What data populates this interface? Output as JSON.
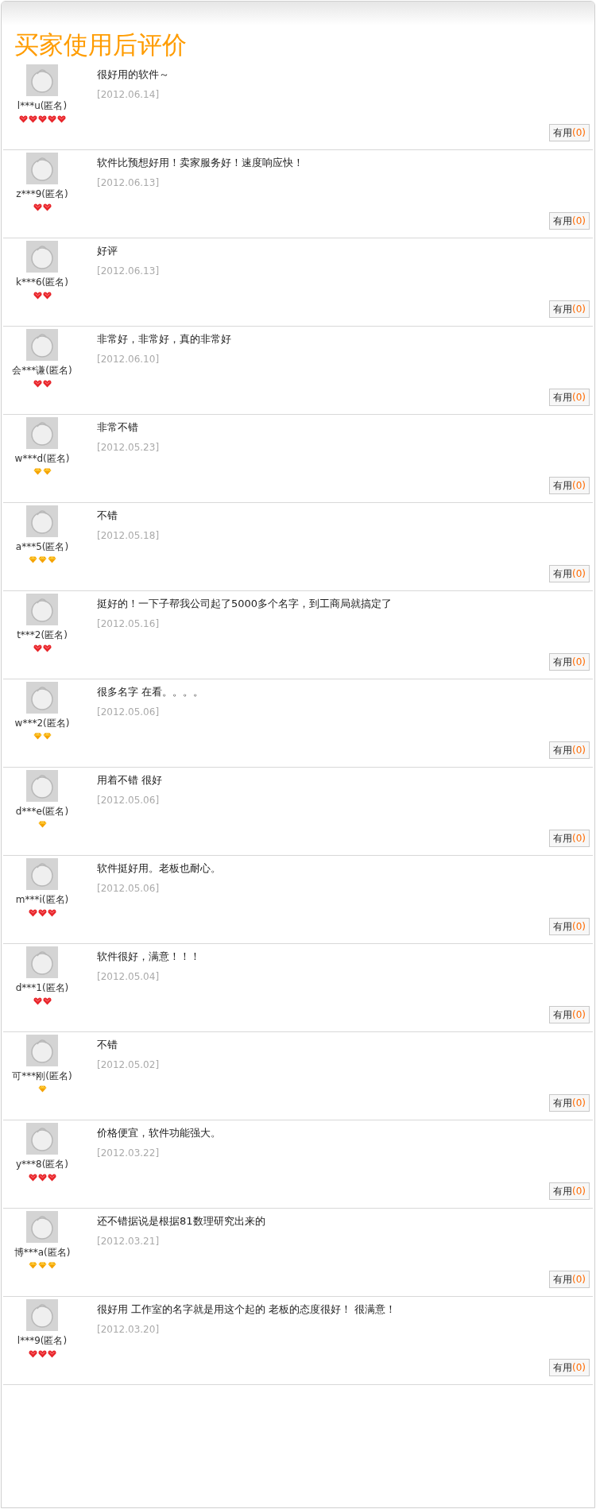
{
  "title": "买家使用后评价",
  "reviews": [
    {
      "user": "l***u(匿名)",
      "badges": [
        {
          "kind": "heart"
        },
        {
          "kind": "heart"
        },
        {
          "kind": "heart"
        },
        {
          "kind": "heart"
        },
        {
          "kind": "heart"
        }
      ],
      "comment": "很好用的软件～",
      "date": "[2012.06.14]",
      "useful_label": "有用",
      "useful_count": "(0)"
    },
    {
      "user": "z***9(匿名)",
      "badges": [
        {
          "kind": "heart"
        },
        {
          "kind": "heart"
        }
      ],
      "comment": "软件比预想好用！卖家服务好！速度响应快！",
      "date": "[2012.06.13]",
      "useful_label": "有用",
      "useful_count": "(0)"
    },
    {
      "user": "k***6(匿名)",
      "badges": [
        {
          "kind": "heart"
        },
        {
          "kind": "heart"
        }
      ],
      "comment": "好评",
      "date": "[2012.06.13]",
      "useful_label": "有用",
      "useful_count": "(0)"
    },
    {
      "user": "会***谦(匿名)",
      "badges": [
        {
          "kind": "heart"
        },
        {
          "kind": "heart"
        }
      ],
      "comment": "非常好，非常好，真的非常好",
      "date": "[2012.06.10]",
      "useful_label": "有用",
      "useful_count": "(0)"
    },
    {
      "user": "w***d(匿名)",
      "badges": [
        {
          "kind": "diamond"
        },
        {
          "kind": "diamond"
        }
      ],
      "comment": "非常不错",
      "date": "[2012.05.23]",
      "useful_label": "有用",
      "useful_count": "(0)"
    },
    {
      "user": "a***5(匿名)",
      "badges": [
        {
          "kind": "diamond"
        },
        {
          "kind": "diamond"
        },
        {
          "kind": "diamond"
        }
      ],
      "comment": "不错",
      "date": "[2012.05.18]",
      "useful_label": "有用",
      "useful_count": "(0)"
    },
    {
      "user": "t***2(匿名)",
      "badges": [
        {
          "kind": "heart"
        },
        {
          "kind": "heart"
        }
      ],
      "comment": "挺好的！一下子帮我公司起了5000多个名字，到工商局就搞定了",
      "date": "[2012.05.16]",
      "useful_label": "有用",
      "useful_count": "(0)"
    },
    {
      "user": "w***2(匿名)",
      "badges": [
        {
          "kind": "diamond"
        },
        {
          "kind": "diamond"
        }
      ],
      "comment": "很多名字 在看。。。。",
      "date": "[2012.05.06]",
      "useful_label": "有用",
      "useful_count": "(0)"
    },
    {
      "user": "d***e(匿名)",
      "badges": [
        {
          "kind": "diamond"
        }
      ],
      "comment": "用着不错 很好",
      "date": "[2012.05.06]",
      "useful_label": "有用",
      "useful_count": "(0)"
    },
    {
      "user": "m***i(匿名)",
      "badges": [
        {
          "kind": "heart"
        },
        {
          "kind": "heart"
        },
        {
          "kind": "heart"
        }
      ],
      "comment": "软件挺好用。老板也耐心。",
      "date": "[2012.05.06]",
      "useful_label": "有用",
      "useful_count": "(0)"
    },
    {
      "user": "d***1(匿名)",
      "badges": [
        {
          "kind": "heart"
        },
        {
          "kind": "heart"
        }
      ],
      "comment": "软件很好，满意！！！",
      "date": "[2012.05.04]",
      "useful_label": "有用",
      "useful_count": "(0)"
    },
    {
      "user": "可***刚(匿名)",
      "badges": [
        {
          "kind": "diamond"
        }
      ],
      "comment": "不错",
      "date": "[2012.05.02]",
      "useful_label": "有用",
      "useful_count": "(0)"
    },
    {
      "user": "y***8(匿名)",
      "badges": [
        {
          "kind": "heart"
        },
        {
          "kind": "heart"
        },
        {
          "kind": "heart"
        }
      ],
      "comment": "价格便宜，软件功能强大。",
      "date": "[2012.03.22]",
      "useful_label": "有用",
      "useful_count": "(0)"
    },
    {
      "user": "博***a(匿名)",
      "badges": [
        {
          "kind": "diamond"
        },
        {
          "kind": "diamond"
        },
        {
          "kind": "diamond"
        }
      ],
      "comment": "还不错据说是根据81数理研究出来的",
      "date": "[2012.03.21]",
      "useful_label": "有用",
      "useful_count": "(0)"
    },
    {
      "user": "l***9(匿名)",
      "badges": [
        {
          "kind": "heart"
        },
        {
          "kind": "heart"
        },
        {
          "kind": "heart"
        }
      ],
      "comment": "很好用 工作室的名字就是用这个起的 老板的态度很好！ 很满意！",
      "date": "[2012.03.20]",
      "useful_label": "有用",
      "useful_count": "(0)"
    }
  ]
}
